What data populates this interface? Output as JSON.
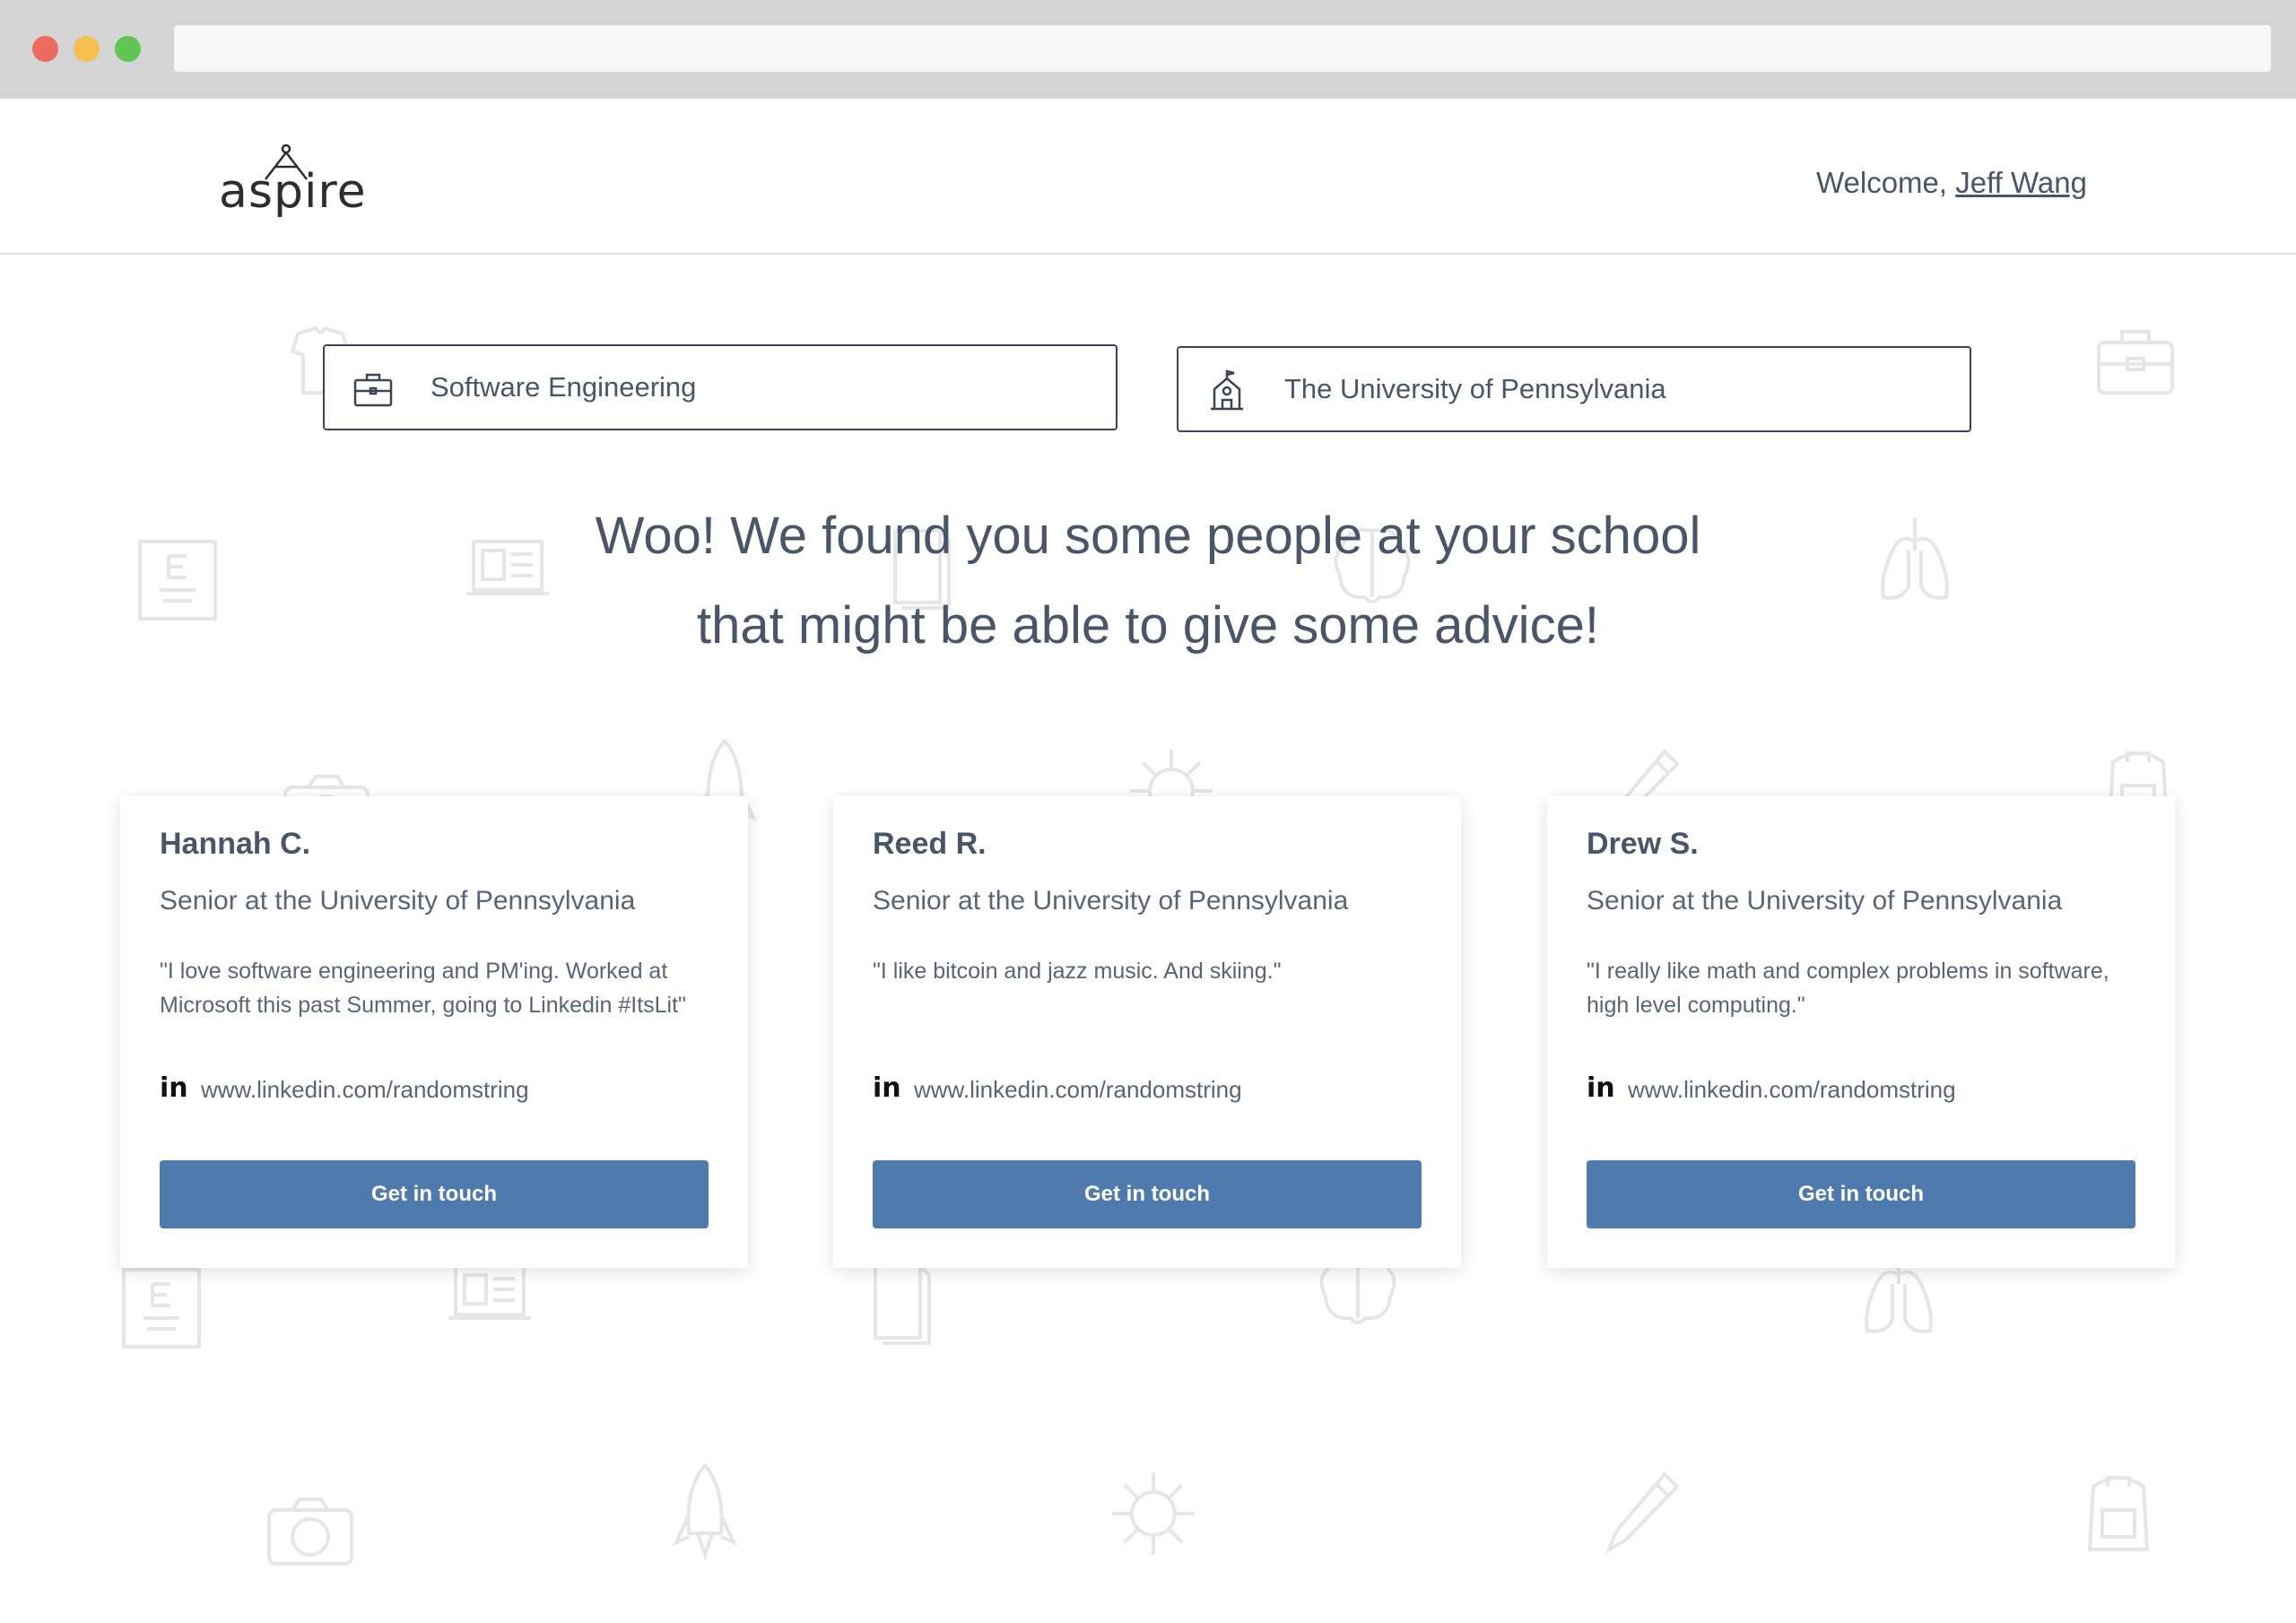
{
  "header": {
    "logo_text": "aspire",
    "welcome_prefix": "Welcome, ",
    "user_name": "Jeff Wang"
  },
  "search": {
    "field_of_interest": "Software Engineering",
    "school": "The University of Pennsylvania"
  },
  "headline": {
    "line1": "Woo! We found you some people at your school",
    "line2": "that might be able to give some advice!"
  },
  "cards": [
    {
      "name": "Hannah C.",
      "role": "Senior at the University of Pennsylvania",
      "quote": "\"I love software engineering and PM'ing. Worked at Microsoft this past Summer, going to Linkedin #ItsLit\"",
      "linkedin_icon": "in",
      "linkedin": "www.linkedin.com/randomstring",
      "button_label": "Get in touch"
    },
    {
      "name": "Reed R.",
      "role": "Senior at the University of Pennsylvania",
      "quote": "\"I like bitcoin and jazz music. And skiing.\"",
      "linkedin_icon": "in",
      "linkedin": "www.linkedin.com/randomstring",
      "button_label": "Get in touch"
    },
    {
      "name": "Drew S.",
      "role": "Senior at the University of Pennsylvania",
      "quote": "\"I really like math and complex problems in software, high level computing.\"",
      "linkedin_icon": "in",
      "linkedin": "www.linkedin.com/randomstring",
      "button_label": "Get in touch"
    }
  ],
  "colors": {
    "accent_button": "#4f7aad",
    "text": "#4a5568",
    "field_border": "#3c4454",
    "pattern": "#e6e6e6"
  },
  "icons": {
    "field_of_interest": "briefcase-icon",
    "school": "school-building-icon",
    "linkedin": "linkedin-icon"
  }
}
